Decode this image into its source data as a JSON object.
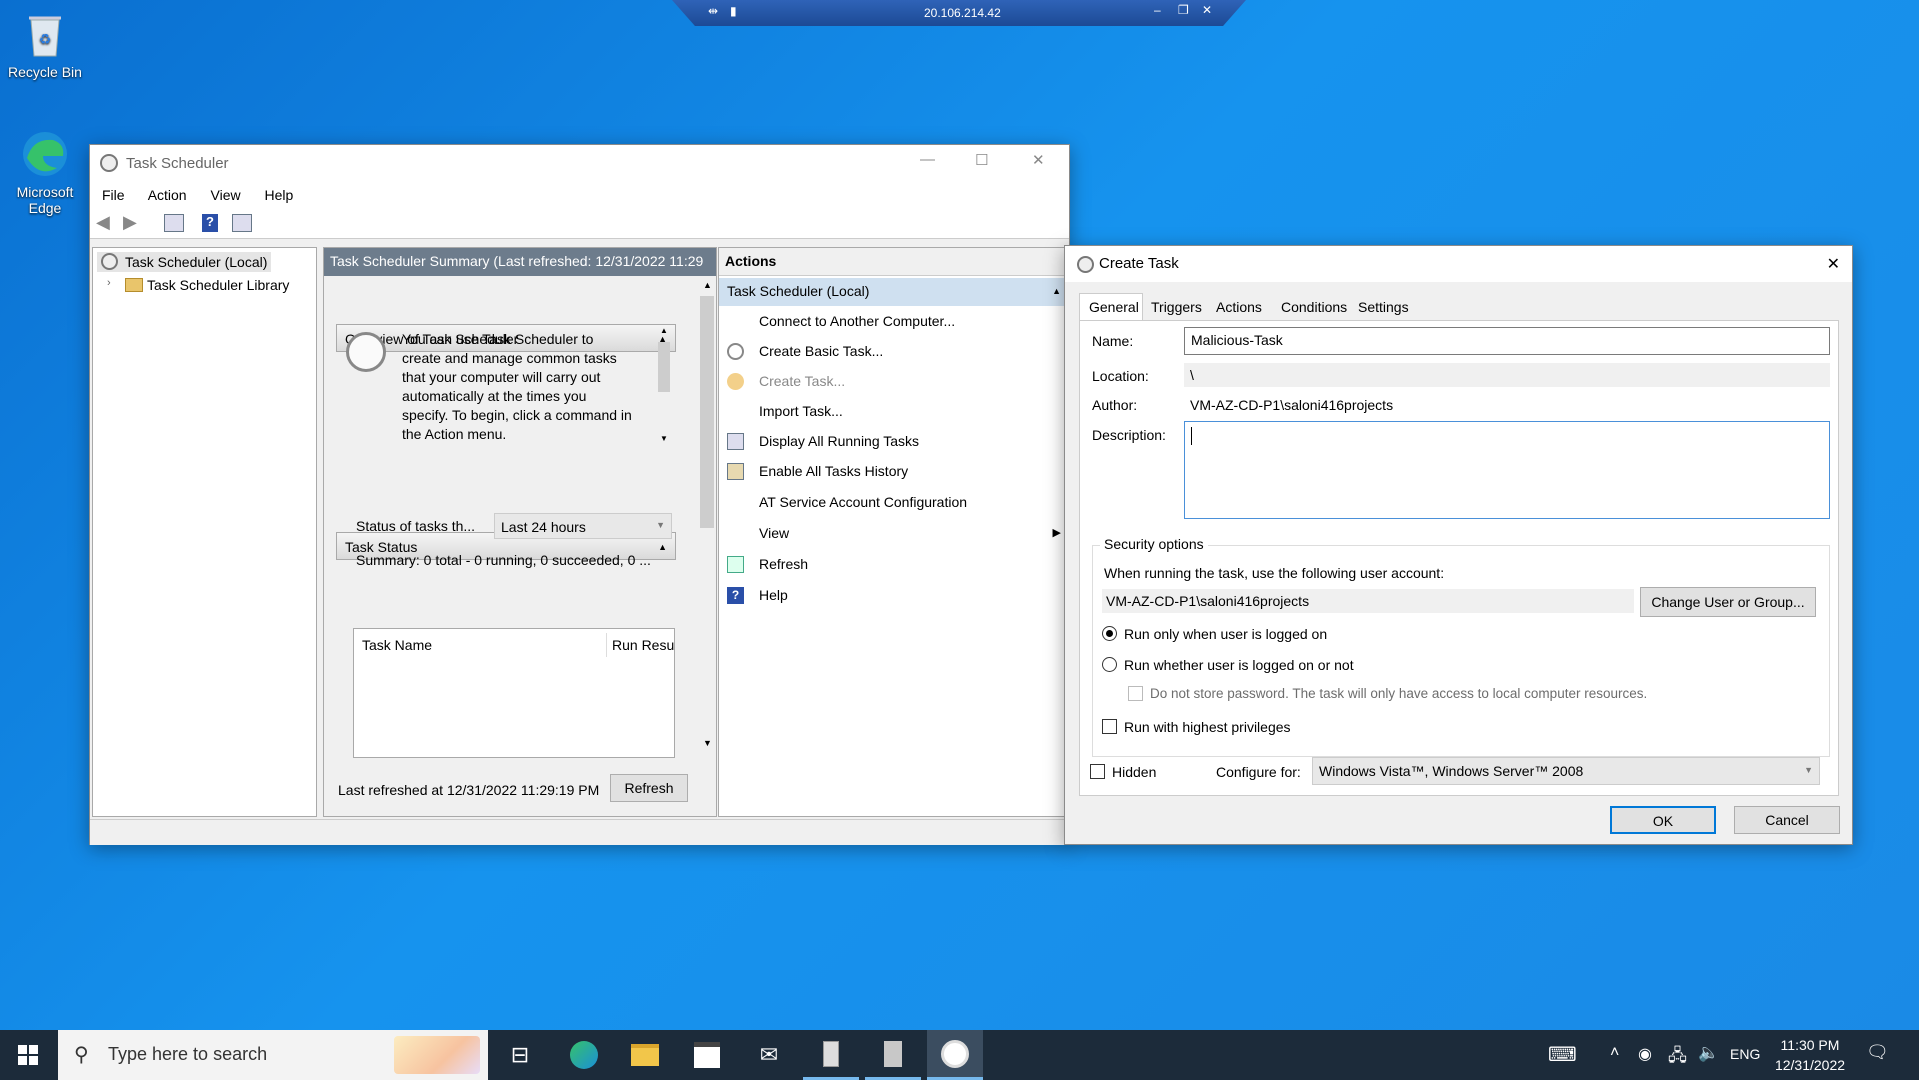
{
  "desktop": {
    "icons": [
      {
        "label": "Recycle Bin"
      },
      {
        "label": "Microsoft Edge"
      }
    ]
  },
  "rdp": {
    "address": "20.106.214.42"
  },
  "taskScheduler": {
    "title": "Task Scheduler",
    "menu": [
      "File",
      "Action",
      "View",
      "Help"
    ],
    "tree": [
      "Task Scheduler (Local)",
      "Task Scheduler Library"
    ],
    "summaryHeader": "Task Scheduler Summary (Last refreshed: 12/31/2022 11:29",
    "overview": {
      "heading": "Overview of Task Scheduler",
      "text": "You can use Task Scheduler to create and manage common tasks that your computer will carry out automatically at the times you specify. To begin, click a command in the Action menu."
    },
    "taskStatus": {
      "heading": "Task Status",
      "statusLabel": "Status of tasks th...",
      "period": "Last 24 hours",
      "summary": "Summary: 0 total - 0 running, 0 succeeded, 0 ...",
      "columns": [
        "Task Name",
        "Run Resu"
      ]
    },
    "lastRefreshed": "Last refreshed at 12/31/2022 11:29:19 PM",
    "refreshButton": "Refresh",
    "actions": {
      "heading": "Actions",
      "group": "Task Scheduler (Local)",
      "items": [
        "Connect to Another Computer...",
        "Create Basic Task...",
        "Create Task...",
        "Import Task...",
        "Display All Running Tasks",
        "Enable All Tasks History",
        "AT Service Account Configuration",
        "View",
        "Refresh",
        "Help"
      ]
    }
  },
  "createTask": {
    "title": "Create Task",
    "tabs": [
      "General",
      "Triggers",
      "Actions",
      "Conditions",
      "Settings"
    ],
    "labels": {
      "name": "Name:",
      "location": "Location:",
      "author": "Author:",
      "description": "Description:"
    },
    "name": "Malicious-Task",
    "location": "\\",
    "author": "VM-AZ-CD-P1\\saloni416projects",
    "description": "",
    "security": {
      "heading": "Security options",
      "accountPrompt": "When running the task, use the following user account:",
      "account": "VM-AZ-CD-P1\\saloni416projects",
      "changeButton": "Change User or Group...",
      "radioLoggedOn": "Run only when user is logged on",
      "radioWhether": "Run whether user is logged on or not",
      "noStorePassword": "Do not store password.  The task will only have access to local computer resources.",
      "highest": "Run with highest privileges"
    },
    "hidden": "Hidden",
    "configureLabel": "Configure for:",
    "configureValue": "Windows Vista™, Windows Server™ 2008",
    "ok": "OK",
    "cancel": "Cancel"
  },
  "taskbar": {
    "searchPlaceholder": "Type here to search",
    "lang": "ENG",
    "time": "11:30 PM",
    "date": "12/31/2022"
  }
}
